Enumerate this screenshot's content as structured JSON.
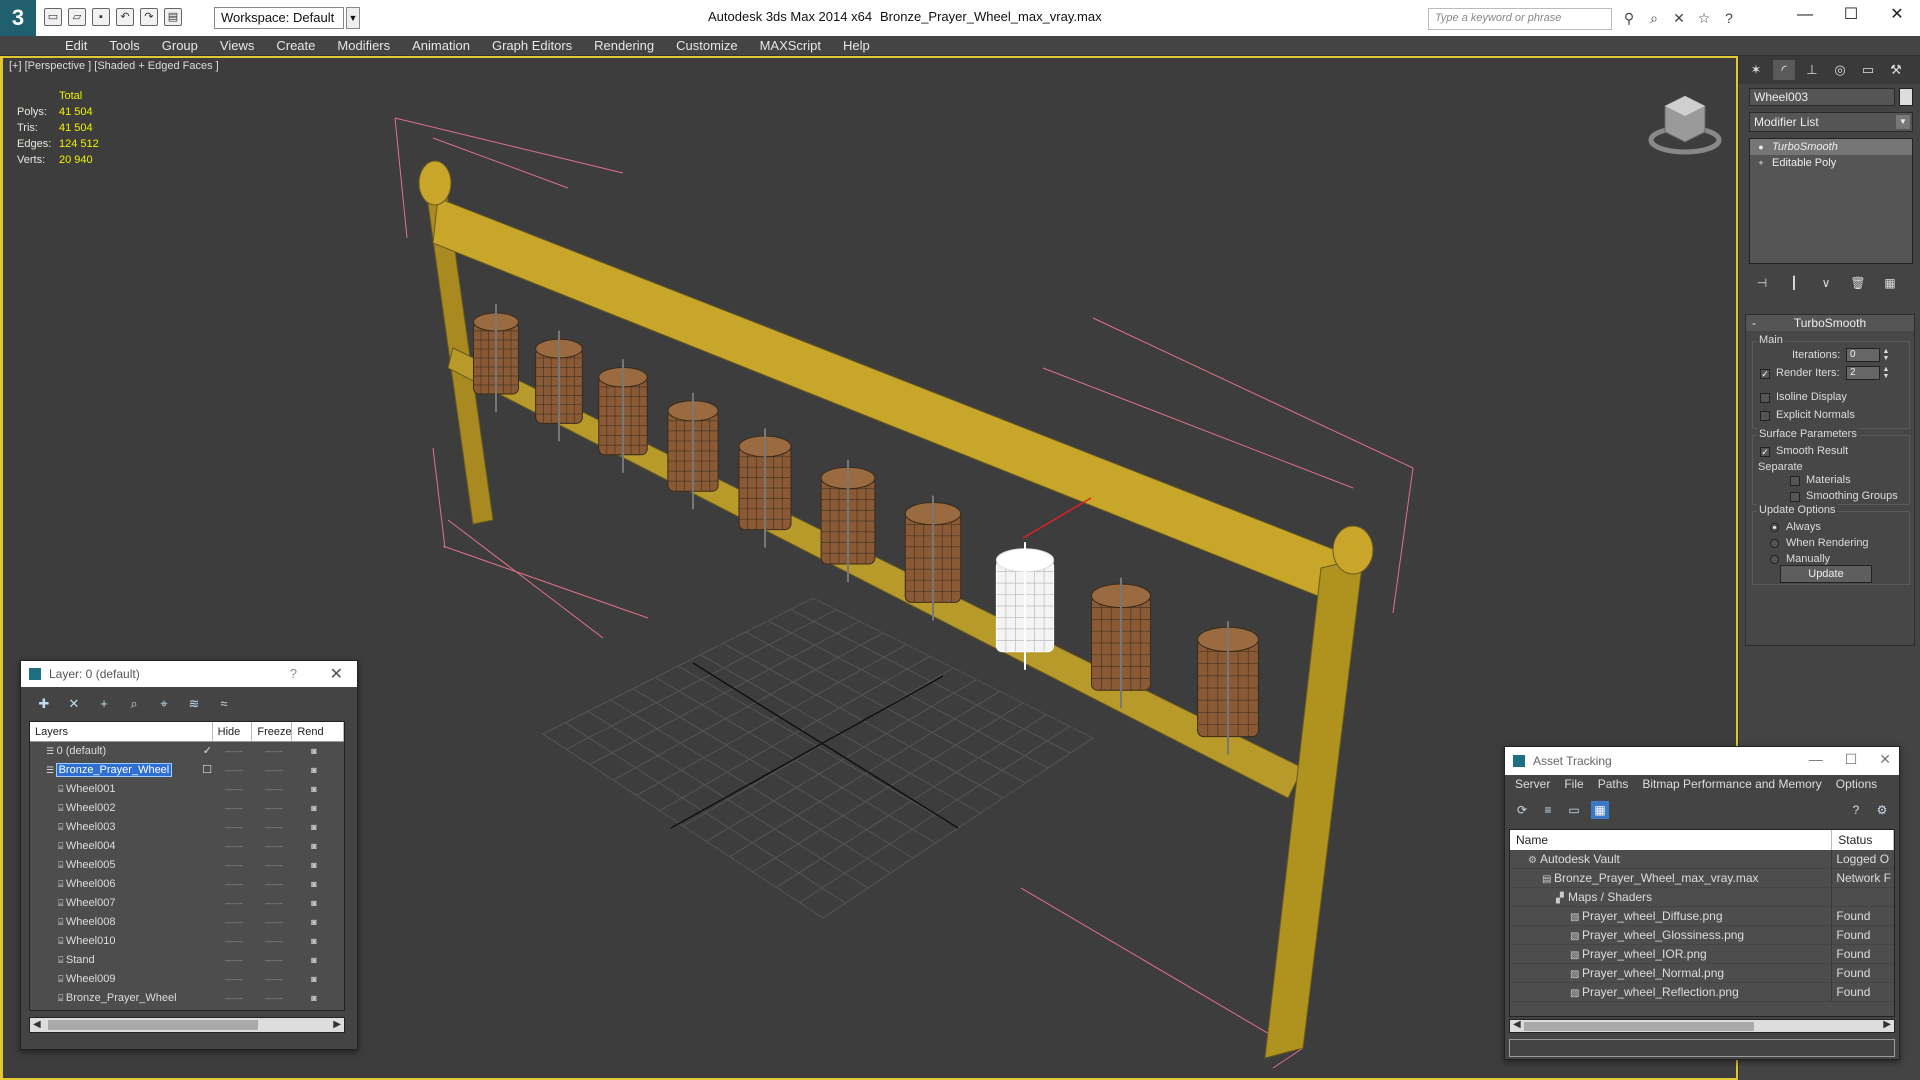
{
  "titlebar": {
    "workspace": "Workspace: Default",
    "app_title": "Autodesk 3ds Max  2014 x64",
    "file_title": "Bronze_Prayer_Wheel_max_vray.max",
    "search_placeholder": "Type a keyword or phrase",
    "icons": [
      "new-icon",
      "open-icon",
      "save-icon",
      "undo-icon",
      "redo-icon",
      "project-icon"
    ],
    "search_icons": [
      "binoculars-icon",
      "search-icon",
      "exchange-icon",
      "star-icon",
      "help-icon"
    ]
  },
  "menubar": [
    "Edit",
    "Tools",
    "Group",
    "Views",
    "Create",
    "Modifiers",
    "Animation",
    "Graph Editors",
    "Rendering",
    "Customize",
    "MAXScript",
    "Help"
  ],
  "viewport": {
    "label": "[+] [Perspective ] [Shaded + Edged Faces ]",
    "stats": {
      "header": "Total",
      "rows": [
        {
          "k": "Polys:",
          "v": "41 504"
        },
        {
          "k": "Tris:",
          "v": "41 504"
        },
        {
          "k": "Edges:",
          "v": "124 512"
        },
        {
          "k": "Verts:",
          "v": "20 940"
        }
      ]
    }
  },
  "command_panel": {
    "tabs": [
      "create-tab-icon",
      "modify-tab-icon",
      "hierarchy-tab-icon",
      "motion-tab-icon",
      "display-tab-icon",
      "utilities-tab-icon"
    ],
    "object_name": "Wheel003",
    "modifier_list": "Modifier List",
    "stack": [
      "TurboSmooth",
      "Editable Poly"
    ],
    "rollout": {
      "title": "TurboSmooth",
      "main_label": "Main",
      "iterations_label": "Iterations:",
      "iterations_value": "0",
      "render_iters_label": "Render Iters:",
      "render_iters_value": "2",
      "isoline": "Isoline Display",
      "explicit": "Explicit Normals",
      "surface_label": "Surface Parameters",
      "smooth_result": "Smooth Result",
      "separate_label": "Separate",
      "materials": "Materials",
      "smoothing_groups": "Smoothing Groups",
      "update_label": "Update Options",
      "always": "Always",
      "when_rendering": "When Rendering",
      "manually": "Manually",
      "update_button": "Update"
    }
  },
  "layer_window": {
    "title": "Layer: 0 (default)",
    "help": "?",
    "columns": [
      "Layers",
      "Hide",
      "Freeze",
      "Rend"
    ],
    "rows": [
      {
        "name": "0 (default)",
        "indent": 1
      },
      {
        "name": "Bronze_Prayer_Wheel",
        "indent": 1
      },
      {
        "name": "Wheel001",
        "indent": 2
      },
      {
        "name": "Wheel002",
        "indent": 2
      },
      {
        "name": "Wheel003",
        "indent": 2
      },
      {
        "name": "Wheel004",
        "indent": 2
      },
      {
        "name": "Wheel005",
        "indent": 2
      },
      {
        "name": "Wheel006",
        "indent": 2
      },
      {
        "name": "Wheel007",
        "indent": 2
      },
      {
        "name": "Wheel008",
        "indent": 2
      },
      {
        "name": "Wheel010",
        "indent": 2
      },
      {
        "name": "Stand",
        "indent": 2
      },
      {
        "name": "Wheel009",
        "indent": 2
      },
      {
        "name": "Bronze_Prayer_Wheel",
        "indent": 2
      }
    ]
  },
  "asset_window": {
    "title": "Asset Tracking",
    "menu": [
      "Server",
      "File",
      "Paths",
      "Bitmap Performance and Memory",
      "Options"
    ],
    "columns": [
      "Name",
      "Status"
    ],
    "rows": [
      {
        "name": "Autodesk Vault",
        "status": "Logged O",
        "indent": 1
      },
      {
        "name": "Bronze_Prayer_Wheel_max_vray.max",
        "status": "Network F",
        "indent": 2
      },
      {
        "name": "Maps / Shaders",
        "status": "",
        "indent": 3
      },
      {
        "name": "Prayer_wheel_Diffuse.png",
        "status": "Found",
        "indent": 4
      },
      {
        "name": "Prayer_wheel_Glossiness.png",
        "status": "Found",
        "indent": 4
      },
      {
        "name": "Prayer_wheel_IOR.png",
        "status": "Found",
        "indent": 4
      },
      {
        "name": "Prayer_wheel_Normal.png",
        "status": "Found",
        "indent": 4
      },
      {
        "name": "Prayer_wheel_Reflection.png",
        "status": "Found",
        "indent": 4
      }
    ]
  },
  "colors": {
    "viewport_bg": "#3d3d3d",
    "selection_border": "#e0c832",
    "stat_value": "#f2f200",
    "wood": "#b89a2a",
    "wheel": "#8a5a36"
  }
}
